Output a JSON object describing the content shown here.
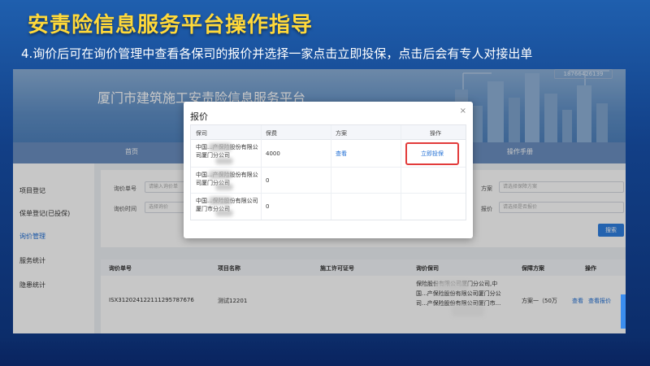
{
  "slide": {
    "title": "安责险信息服务平台操作指导",
    "subtitle": "4.询价后可在询价管理中查看各保司的报价并选择一家点击立即投保，点击后会有专人对接出单"
  },
  "app": {
    "title": "厦门市建筑施工安责险信息服务平台",
    "phone": "18766426139",
    "nav": [
      "首页",
      "操作手册"
    ],
    "sidebar": [
      {
        "label": "项目登记",
        "active": false
      },
      {
        "label": "保单登记(已投保)",
        "active": false
      },
      {
        "label": "询价管理",
        "active": true
      },
      {
        "label": "服务统计",
        "active": false
      },
      {
        "label": "隐患统计",
        "active": false
      }
    ]
  },
  "filters": {
    "inquiry_no_label": "询价单号",
    "inquiry_no_placeholder": "请输入询价单",
    "inquiry_time_label": "询价时间",
    "inquiry_time_placeholder": "选择询价",
    "plan_label": "方案",
    "plan_placeholder": "请选择保障方案",
    "quote_label": "报价",
    "quote_placeholder": "请选择是否报价",
    "search_label": "搜索"
  },
  "list_table": {
    "headers": [
      "询价单号",
      "项目名称",
      "施工许可证号",
      "询价保司",
      "保障方案",
      "操作"
    ],
    "row": {
      "inquiry_no": "ISX3120241221112957876​76",
      "project": "测试12201",
      "permit": "",
      "insurers": "保险股份有限公司厦门分公司,中国...产保险股份有限公司厦门分公司...产保险股份有限公司厦门市...",
      "plan": "方案一（50万",
      "actions": [
        "查看",
        "查看报价"
      ]
    }
  },
  "modal": {
    "title": "报价",
    "close": "×",
    "headers": [
      "保司",
      "保费",
      "方案",
      "操作"
    ],
    "rows": [
      {
        "insurer": "中国...产保险股份有限公司厦门分公司",
        "premium": "4000",
        "plan": "查看",
        "action": "立即投保"
      },
      {
        "insurer": "中国...产保险股份有限公司厦门分公司",
        "premium": "0",
        "plan": "",
        "action": ""
      },
      {
        "insurer": "中国...保险股份有限公司厦门市分公司",
        "premium": "0",
        "plan": "",
        "action": ""
      }
    ]
  },
  "colors": {
    "slide_title": "#ffd93a",
    "highlight_border": "#e23b3b",
    "link": "#1f6ed4"
  }
}
